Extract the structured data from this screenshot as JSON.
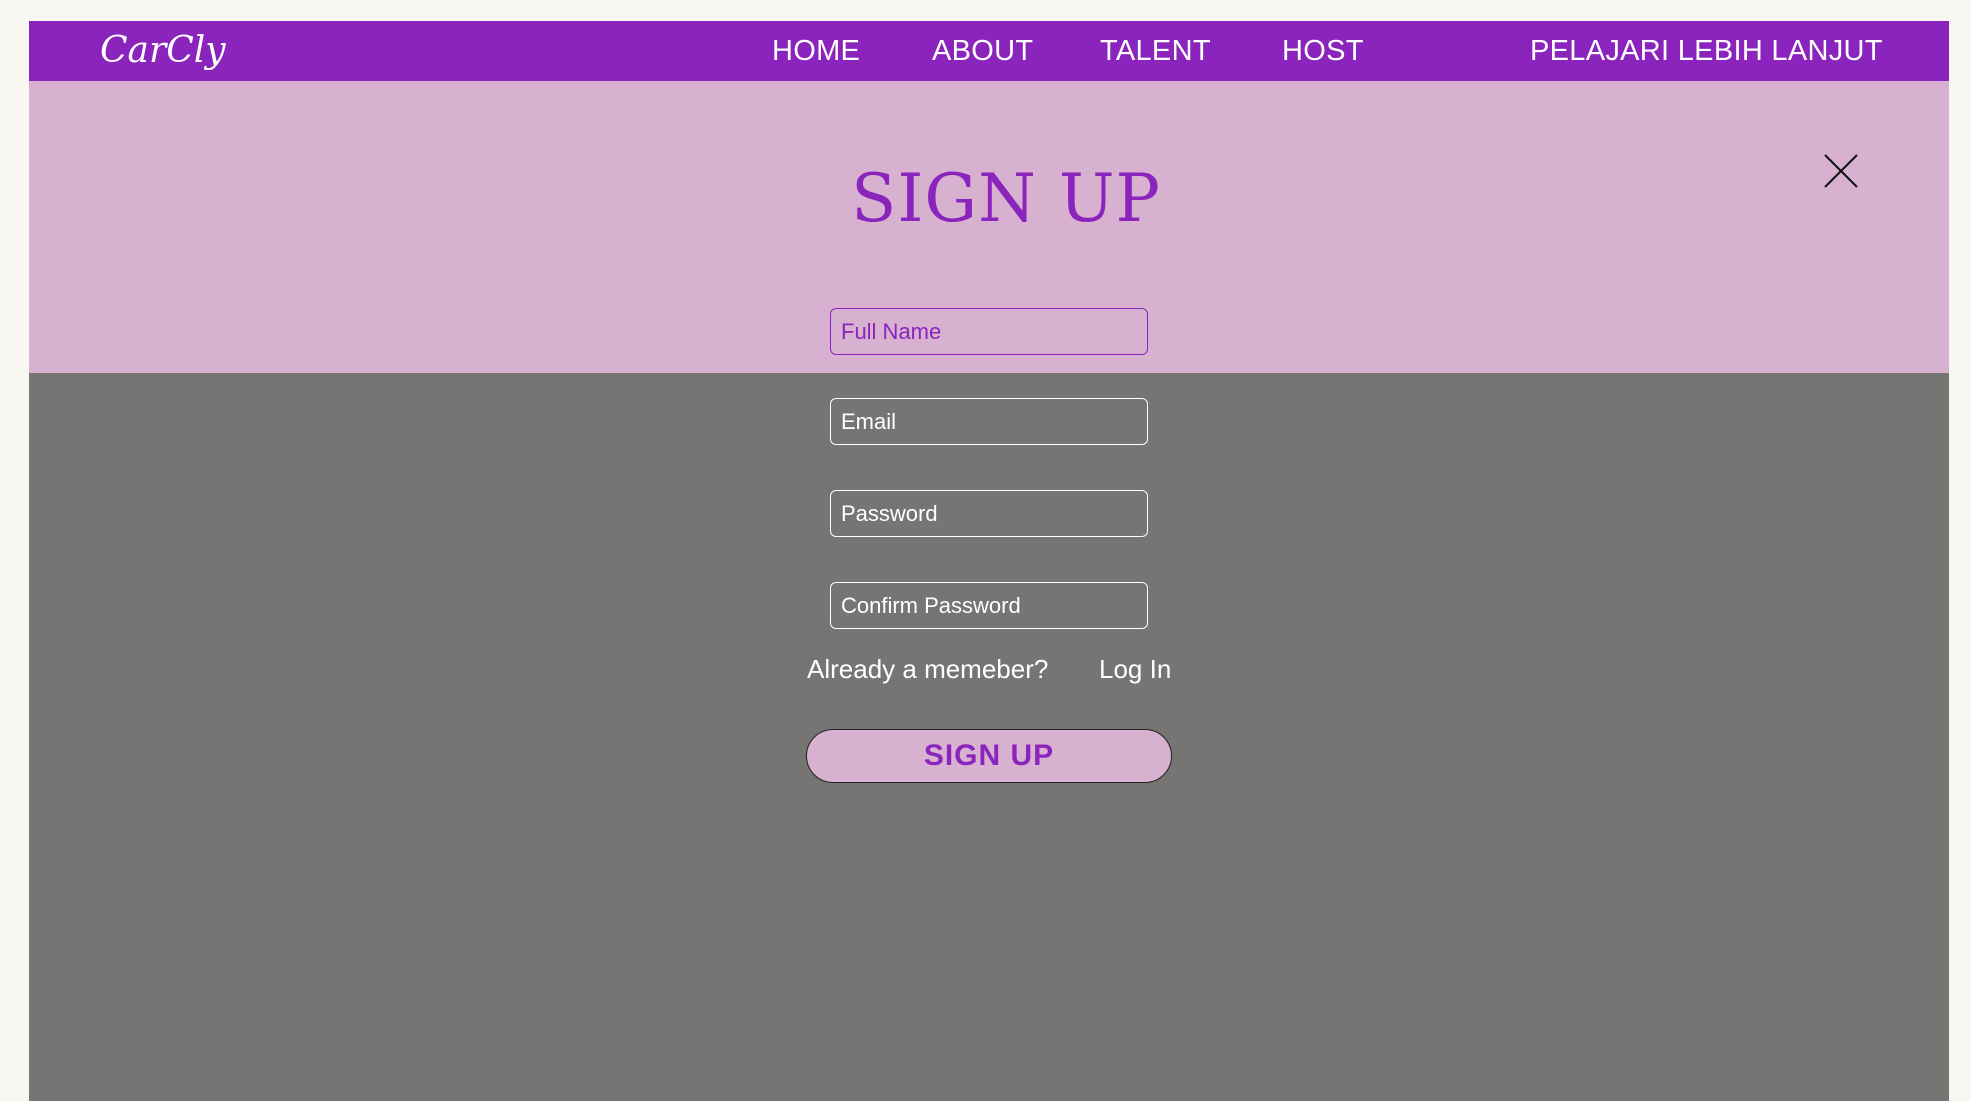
{
  "navbar": {
    "logo": "CarCly",
    "links": [
      "HOME",
      "ABOUT",
      "TALENT",
      "HOST"
    ],
    "cta": "PELAJARI LEBIH LANJUT"
  },
  "modal": {
    "title": "SIGN UP",
    "close_icon": "close-icon",
    "fields": {
      "full_name": {
        "placeholder": "Full Name",
        "value": ""
      },
      "email": {
        "placeholder": "Email",
        "value": ""
      },
      "password": {
        "placeholder": "Password",
        "value": ""
      },
      "confirm_password": {
        "placeholder": "Confirm Password",
        "value": ""
      }
    },
    "member_prompt": "Already a memeber?",
    "login_link": "Log In",
    "submit_label": "SIGN UP"
  },
  "colors": {
    "brand_purple": "#8a24bd",
    "pink_band": "#d8b1d0",
    "overlay_gray": "#767573",
    "outer_background": "#f8f7f2"
  }
}
